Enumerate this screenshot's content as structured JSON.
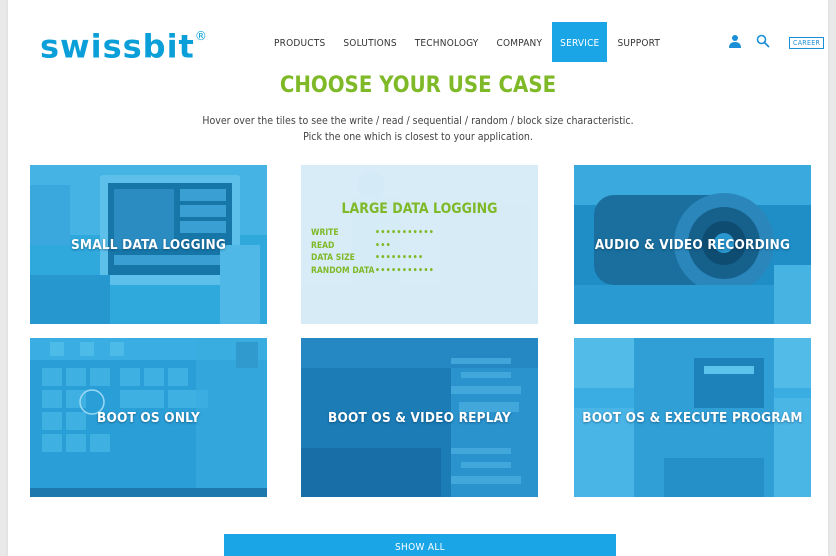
{
  "header": {
    "logo": "swissbit",
    "logo_mark": "®",
    "nav": [
      {
        "label": "PRODUCTS",
        "active": false
      },
      {
        "label": "SOLUTIONS",
        "active": false
      },
      {
        "label": "TECHNOLOGY",
        "active": false
      },
      {
        "label": "COMPANY",
        "active": false
      },
      {
        "label": "SERVICE",
        "active": true
      },
      {
        "label": "SUPPORT",
        "active": false
      }
    ],
    "career": "CAREER"
  },
  "main": {
    "title": "CHOOSE YOUR USE CASE",
    "subtitle_line1": "Hover over the tiles to see the write / read / sequential / random / block size characteristic.",
    "subtitle_line2": "Pick the one which is closest to your application."
  },
  "tiles": [
    {
      "label": "SMALL DATA LOGGING"
    },
    {
      "label": "LARGE DATA LOGGING",
      "hovered": true,
      "characteristics": [
        {
          "name": "WRITE",
          "dots": "•••••••••••"
        },
        {
          "name": "READ",
          "dots": "•••"
        },
        {
          "name": "DATA SIZE",
          "dots": "•••••••••"
        },
        {
          "name": "RANDOM DATA",
          "dots": "•••••••••••"
        }
      ]
    },
    {
      "label": "AUDIO & VIDEO RECORDING"
    },
    {
      "label": "BOOT OS ONLY"
    },
    {
      "label": "BOOT OS & VIDEO REPLAY"
    },
    {
      "label": "BOOT OS & EXECUTE PROGRAM"
    }
  ],
  "footer": {
    "show_all": "SHOW ALL"
  },
  "colors": {
    "brand_blue": "#1aa6e6",
    "accent_green": "#7fb928"
  }
}
